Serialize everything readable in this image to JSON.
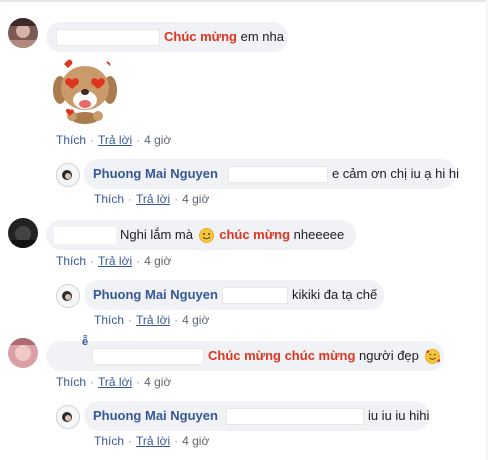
{
  "comments": [
    {
      "text_red": "Chúc mừng",
      "text_after": "em nha",
      "actions": {
        "like": "Thích",
        "reply": "Trả lời",
        "time": "4 giờ"
      }
    },
    {
      "name": "Phuong Mai Nguyen",
      "text": "e cảm ơn chị iu ạ hi hi",
      "actions": {
        "like": "Thích",
        "reply": "Trả lời",
        "time": "4 giờ"
      }
    },
    {
      "text_before": "Nghi lắm mà",
      "text_red": "chúc mừng",
      "text_after": "nheeeee",
      "actions": {
        "like": "Thích",
        "reply": "Trả lời",
        "time": "4 giờ"
      }
    },
    {
      "name": "Phuong Mai Nguyen",
      "text": "kikiki đa tạ chế",
      "actions": {
        "like": "Thích",
        "reply": "Trả lời",
        "time": "4 giờ"
      }
    },
    {
      "name_fragment": "ễ",
      "text_red": "Chúc mừng chúc mừng",
      "text_after": "người đẹp",
      "actions": {
        "like": "Thích",
        "reply": "Trả lời",
        "time": "4 giờ"
      }
    },
    {
      "name": "Phuong Mai Nguyen",
      "text": "iu iu iu hihi",
      "actions": {
        "like": "Thích",
        "reply": "Trả lời",
        "time": "4 giờ"
      }
    }
  ],
  "icons": {
    "sticker": "heart-eyes-dog-sticker-icon",
    "smile": "smile-emoji-icon",
    "hearts": "smiling-face-with-hearts-emoji-icon"
  },
  "colors": {
    "link": "#365899",
    "highlight": "#e0341f",
    "bubble": "#f0f2f5"
  }
}
